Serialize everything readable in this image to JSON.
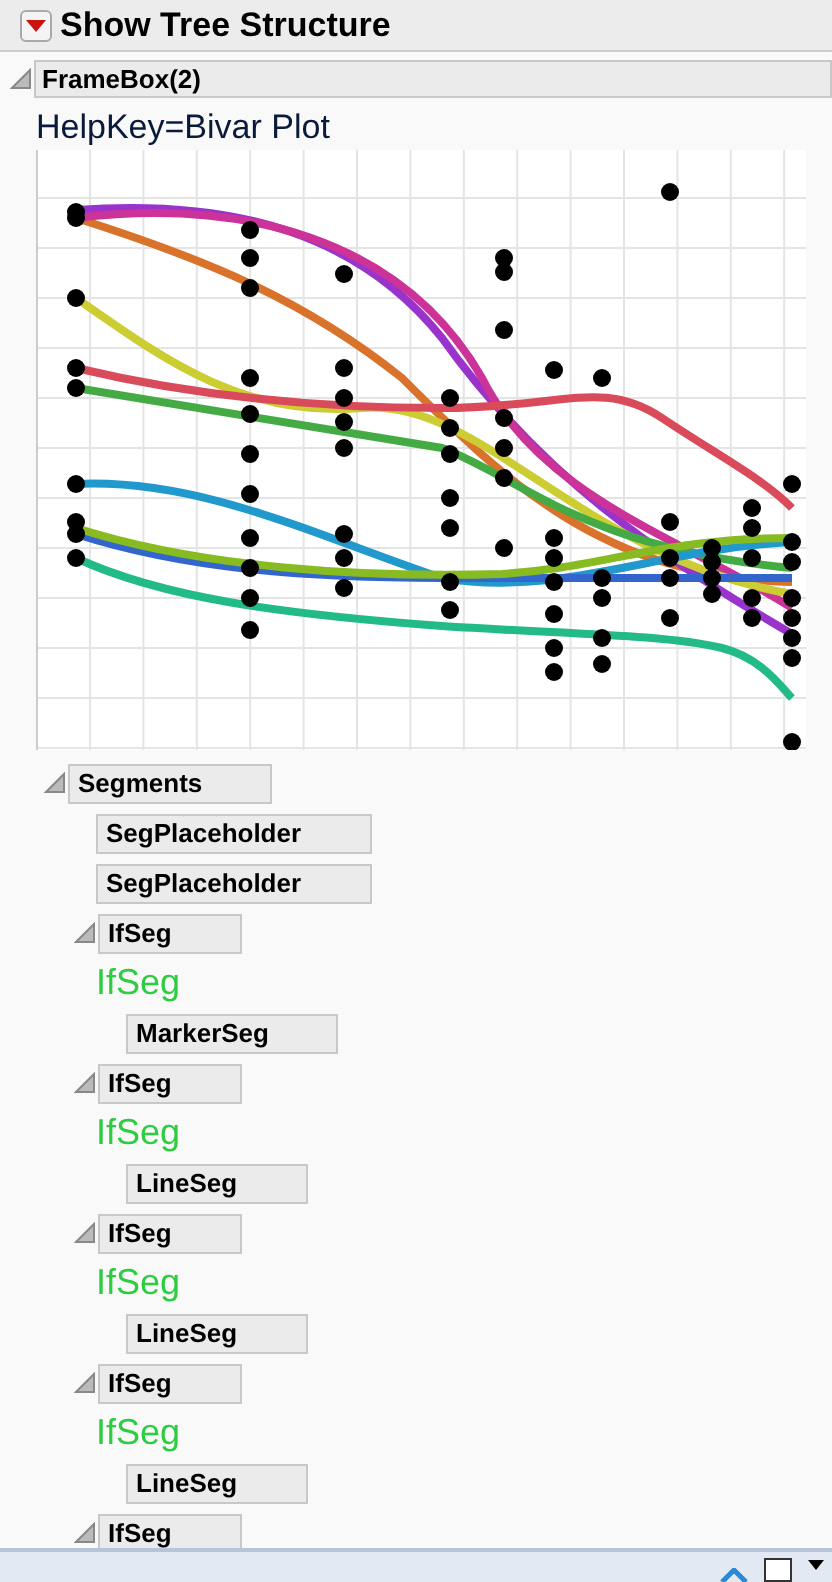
{
  "header": {
    "title": "Show Tree Structure"
  },
  "frame_box": {
    "label": "FrameBox(2)",
    "expanded": true,
    "help_key": "HelpKey=Bivar Plot"
  },
  "tree": [
    {
      "kind": "node",
      "label": "Segments",
      "expanded": true,
      "children": [
        {
          "kind": "leaf",
          "label": "SegPlaceholder"
        },
        {
          "kind": "leaf",
          "label": "SegPlaceholder"
        },
        {
          "kind": "node",
          "label": "IfSeg",
          "expanded": true,
          "children": [
            {
              "kind": "text",
              "label": "IfSeg"
            },
            {
              "kind": "leaf",
              "label": "MarkerSeg"
            }
          ]
        },
        {
          "kind": "node",
          "label": "IfSeg",
          "expanded": true,
          "children": [
            {
              "kind": "text",
              "label": "IfSeg"
            },
            {
              "kind": "leaf",
              "label": "LineSeg"
            }
          ]
        },
        {
          "kind": "node",
          "label": "IfSeg",
          "expanded": true,
          "children": [
            {
              "kind": "text",
              "label": "IfSeg"
            },
            {
              "kind": "leaf",
              "label": "LineSeg"
            }
          ]
        },
        {
          "kind": "node",
          "label": "IfSeg",
          "expanded": true,
          "children": [
            {
              "kind": "text",
              "label": "IfSeg"
            },
            {
              "kind": "leaf",
              "label": "LineSeg"
            }
          ]
        },
        {
          "kind": "node",
          "label": "IfSeg",
          "expanded": true
        }
      ]
    }
  ],
  "status_bar": {
    "checkbox": {
      "checked": false
    }
  }
}
